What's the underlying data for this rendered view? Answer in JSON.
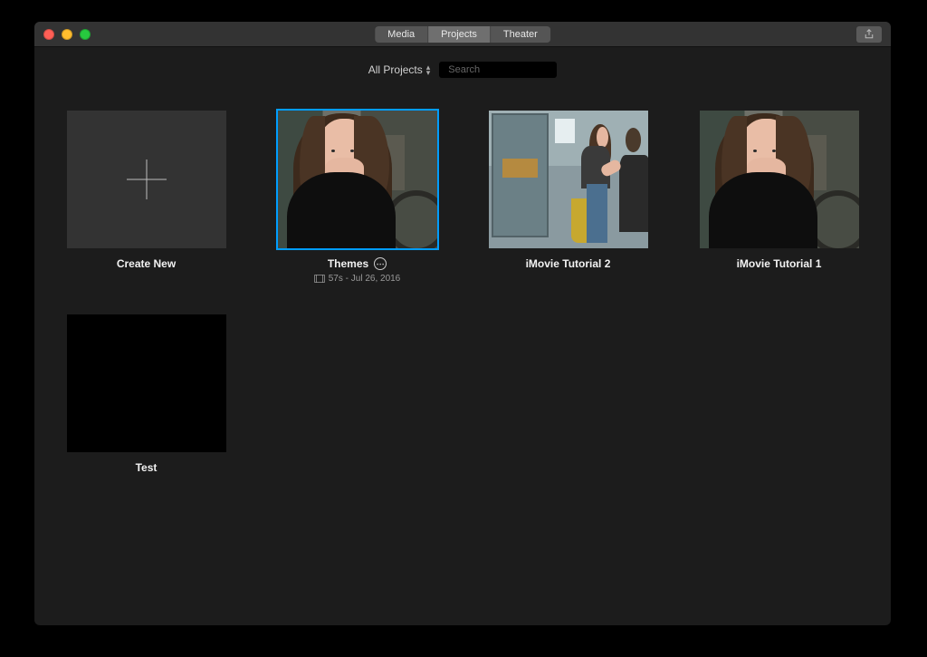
{
  "tabs": {
    "media": "Media",
    "projects": "Projects",
    "theater": "Theater",
    "active": "projects"
  },
  "filter": {
    "label": "All Projects"
  },
  "search": {
    "placeholder": "Search",
    "value": ""
  },
  "projects": {
    "create": {
      "label": "Create New"
    },
    "items": [
      {
        "label": "Themes",
        "meta": "57s - Jul 26, 2016",
        "selected": true,
        "thumb": "woman"
      },
      {
        "label": "iMovie Tutorial 2",
        "thumb": "shop"
      },
      {
        "label": "iMovie Tutorial 1",
        "thumb": "woman"
      },
      {
        "label": "Test",
        "thumb": "black"
      }
    ]
  }
}
